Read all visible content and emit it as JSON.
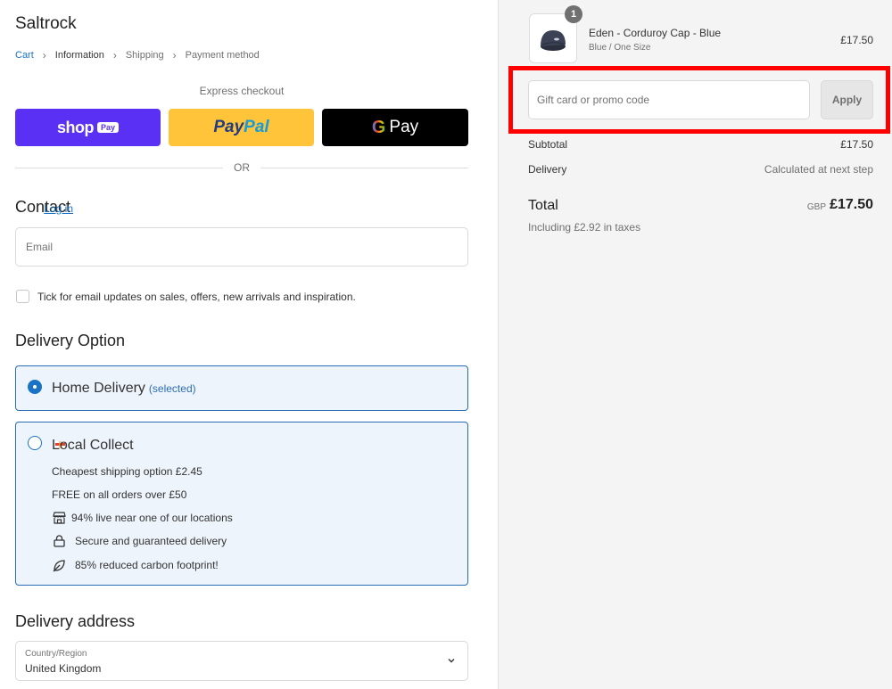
{
  "store": {
    "name": "Saltrock"
  },
  "breadcrumb": [
    {
      "label": "Cart",
      "state": "link"
    },
    {
      "label": "Information",
      "state": "current"
    },
    {
      "label": "Shipping",
      "state": "upcoming"
    },
    {
      "label": "Payment method",
      "state": "upcoming"
    }
  ],
  "express": {
    "label": "Express checkout",
    "shop_pay": {
      "word": "shop",
      "tag": "Pay"
    },
    "paypal": {
      "part_a": "Pay",
      "part_b": "Pal"
    },
    "gpay": {
      "g": "G",
      "word": "Pay"
    },
    "or_text": "OR"
  },
  "contact": {
    "title": "Contact",
    "login_link": "Log in",
    "email_placeholder": "Email",
    "marketing_label": "Tick for email updates on sales, offers, new arrivals and inspiration."
  },
  "delivery_option": {
    "title": "Delivery Option",
    "home": {
      "label": "Home Delivery",
      "selected_note": "(selected)"
    },
    "collect": {
      "label": "Local Collect",
      "lines": [
        {
          "icon": "none",
          "text": "Cheapest shipping option £2.45"
        },
        {
          "icon": "none",
          "text": "FREE on all orders over £50"
        },
        {
          "icon": "store-icon",
          "text": "94% live near one of our locations"
        },
        {
          "icon": "lock-icon",
          "text": "Secure and guaranteed delivery"
        },
        {
          "icon": "leaf-icon",
          "text": "85% reduced carbon footprint!"
        }
      ]
    }
  },
  "delivery_address": {
    "title": "Delivery address",
    "country_label": "Country/Region",
    "country_value": "United Kingdom"
  },
  "order": {
    "product": {
      "quantity": "1",
      "name": "Eden - Corduroy Cap - Blue",
      "variant": "Blue / One Size",
      "price": "£17.50"
    },
    "promo_placeholder": "Gift card or promo code",
    "apply_label": "Apply",
    "subtotal_label": "Subtotal",
    "subtotal_value": "£17.50",
    "delivery_label": "Delivery",
    "delivery_value": "Calculated at next step",
    "total_label": "Total",
    "total_currency": "GBP",
    "total_value": "£17.50",
    "tax_note": "Including £2.92 in taxes"
  },
  "colors": {
    "shop_pay": "#5a31f4",
    "paypal": "#ffc439",
    "gpay": "#000000",
    "link": "#1a73c5",
    "selected_border": "#2a6db5",
    "highlight": "#ff0000"
  }
}
